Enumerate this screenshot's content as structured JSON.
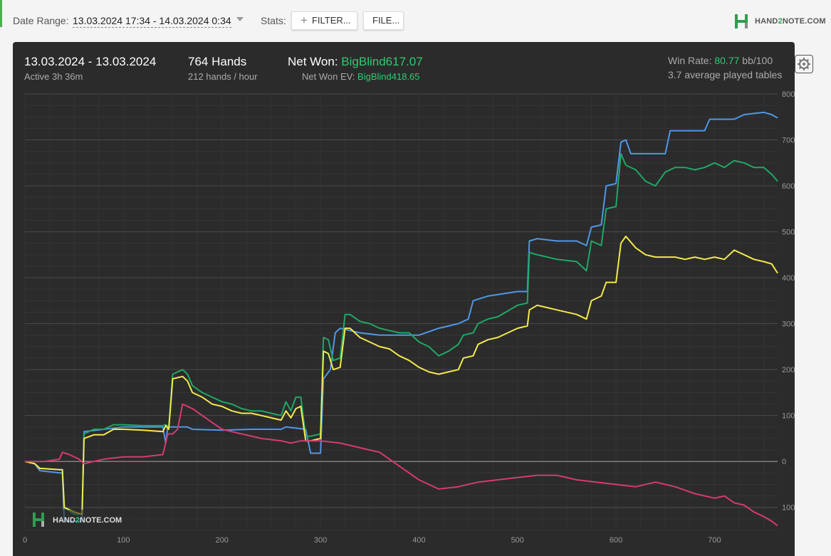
{
  "toolbar": {
    "date_range_label": "Date Range:",
    "date_range_value": "13.03.2024 17:34 - 14.03.2024 0:34",
    "stats_label": "Stats:",
    "filter_button": "FILTER...",
    "file_button": "FILE...",
    "logo_text_a": "HAND",
    "logo_text_b": "2",
    "logo_text_c": "NOTE.COM"
  },
  "summary": {
    "date_range": "13.03.2024 - 13.03.2024",
    "active": "Active 3h 36m",
    "hands": "764 Hands",
    "hands_per_hour": "212 hands / hour",
    "net_won_label": "Net Won: ",
    "net_won_value": "BigBlind617.07",
    "net_won_ev_label": "Net Won  EV: ",
    "net_won_ev_value": "BigBlind418.65",
    "win_rate_label": "Win Rate: ",
    "win_rate_value": "80.77",
    "win_rate_unit": " bb/100",
    "tables": "3.7 average played tables"
  },
  "watermark": {
    "a": "HAND",
    "b": "2",
    "c": "NOTE.COM"
  },
  "colors": {
    "background": "#2b2b2b",
    "green": "#1fa866",
    "blue": "#4f97e8",
    "yellow": "#f2ea4c",
    "red": "#d63a72",
    "accent": "#2ecc71"
  },
  "chart_data": {
    "type": "line",
    "xlim": [
      0,
      764
    ],
    "ylim": [
      -150,
      800
    ],
    "x_ticks": [
      "0",
      "100",
      "200",
      "300",
      "400",
      "500",
      "600",
      "700"
    ],
    "y_ticks": [
      "800",
      "700",
      "600",
      "500",
      "400",
      "300",
      "200",
      "100",
      "0",
      "100"
    ],
    "y_tick_values": [
      800,
      700,
      600,
      500,
      400,
      300,
      200,
      100,
      0,
      -100
    ],
    "grid": true,
    "series": [
      {
        "color": "blue",
        "points": [
          [
            0,
            0
          ],
          [
            10,
            -5
          ],
          [
            15,
            -20
          ],
          [
            35,
            -25
          ],
          [
            38,
            -25
          ],
          [
            40,
            -130
          ],
          [
            58,
            -130
          ],
          [
            60,
            65
          ],
          [
            100,
            75
          ],
          [
            140,
            75
          ],
          [
            143,
            40
          ],
          [
            145,
            75
          ],
          [
            165,
            75
          ],
          [
            170,
            70
          ],
          [
            200,
            68
          ],
          [
            230,
            70
          ],
          [
            260,
            70
          ],
          [
            265,
            75
          ],
          [
            285,
            70
          ],
          [
            290,
            18
          ],
          [
            300,
            18
          ],
          [
            303,
            180
          ],
          [
            310,
            200
          ],
          [
            315,
            280
          ],
          [
            320,
            290
          ],
          [
            340,
            280
          ],
          [
            360,
            275
          ],
          [
            380,
            275
          ],
          [
            400,
            275
          ],
          [
            420,
            290
          ],
          [
            440,
            300
          ],
          [
            450,
            310
          ],
          [
            455,
            350
          ],
          [
            470,
            360
          ],
          [
            500,
            370
          ],
          [
            510,
            370
          ],
          [
            512,
            480
          ],
          [
            520,
            485
          ],
          [
            540,
            480
          ],
          [
            560,
            480
          ],
          [
            570,
            470
          ],
          [
            575,
            510
          ],
          [
            585,
            515
          ],
          [
            590,
            600
          ],
          [
            600,
            605
          ],
          [
            605,
            695
          ],
          [
            610,
            700
          ],
          [
            615,
            670
          ],
          [
            640,
            670
          ],
          [
            650,
            670
          ],
          [
            655,
            720
          ],
          [
            680,
            720
          ],
          [
            690,
            720
          ],
          [
            695,
            745
          ],
          [
            720,
            745
          ],
          [
            730,
            755
          ],
          [
            750,
            760
          ],
          [
            758,
            755
          ],
          [
            764,
            748
          ]
        ]
      },
      {
        "color": "green",
        "points": [
          [
            0,
            0
          ],
          [
            10,
            -5
          ],
          [
            15,
            -15
          ],
          [
            35,
            -18
          ],
          [
            38,
            -18
          ],
          [
            40,
            -100
          ],
          [
            50,
            -115
          ],
          [
            58,
            -115
          ],
          [
            60,
            60
          ],
          [
            70,
            70
          ],
          [
            80,
            70
          ],
          [
            90,
            80
          ],
          [
            100,
            80
          ],
          [
            120,
            78
          ],
          [
            140,
            78
          ],
          [
            143,
            80
          ],
          [
            146,
            75
          ],
          [
            150,
            190
          ],
          [
            160,
            200
          ],
          [
            165,
            190
          ],
          [
            170,
            165
          ],
          [
            180,
            150
          ],
          [
            190,
            140
          ],
          [
            200,
            130
          ],
          [
            210,
            125
          ],
          [
            220,
            115
          ],
          [
            230,
            110
          ],
          [
            240,
            110
          ],
          [
            250,
            105
          ],
          [
            260,
            100
          ],
          [
            265,
            130
          ],
          [
            270,
            110
          ],
          [
            275,
            140
          ],
          [
            280,
            140
          ],
          [
            285,
            55
          ],
          [
            290,
            55
          ],
          [
            300,
            60
          ],
          [
            303,
            270
          ],
          [
            308,
            265
          ],
          [
            313,
            220
          ],
          [
            320,
            225
          ],
          [
            325,
            320
          ],
          [
            330,
            320
          ],
          [
            340,
            305
          ],
          [
            350,
            300
          ],
          [
            360,
            290
          ],
          [
            370,
            285
          ],
          [
            380,
            280
          ],
          [
            390,
            280
          ],
          [
            400,
            260
          ],
          [
            410,
            250
          ],
          [
            420,
            230
          ],
          [
            430,
            240
          ],
          [
            440,
            255
          ],
          [
            445,
            275
          ],
          [
            455,
            280
          ],
          [
            460,
            300
          ],
          [
            470,
            310
          ],
          [
            480,
            315
          ],
          [
            500,
            340
          ],
          [
            510,
            345
          ],
          [
            512,
            455
          ],
          [
            520,
            450
          ],
          [
            540,
            440
          ],
          [
            560,
            435
          ],
          [
            570,
            415
          ],
          [
            575,
            480
          ],
          [
            585,
            470
          ],
          [
            590,
            550
          ],
          [
            600,
            555
          ],
          [
            605,
            670
          ],
          [
            610,
            645
          ],
          [
            620,
            635
          ],
          [
            630,
            610
          ],
          [
            640,
            600
          ],
          [
            650,
            630
          ],
          [
            660,
            640
          ],
          [
            670,
            640
          ],
          [
            680,
            635
          ],
          [
            690,
            640
          ],
          [
            700,
            650
          ],
          [
            710,
            640
          ],
          [
            720,
            655
          ],
          [
            730,
            650
          ],
          [
            740,
            640
          ],
          [
            750,
            640
          ],
          [
            758,
            625
          ],
          [
            764,
            610
          ]
        ]
      },
      {
        "color": "yellow",
        "points": [
          [
            0,
            0
          ],
          [
            10,
            -5
          ],
          [
            15,
            -15
          ],
          [
            35,
            -18
          ],
          [
            38,
            -18
          ],
          [
            40,
            -100
          ],
          [
            50,
            -110
          ],
          [
            58,
            -115
          ],
          [
            60,
            50
          ],
          [
            70,
            58
          ],
          [
            80,
            58
          ],
          [
            90,
            70
          ],
          [
            100,
            70
          ],
          [
            120,
            68
          ],
          [
            140,
            65
          ],
          [
            143,
            78
          ],
          [
            146,
            70
          ],
          [
            150,
            180
          ],
          [
            160,
            185
          ],
          [
            165,
            175
          ],
          [
            170,
            150
          ],
          [
            180,
            140
          ],
          [
            190,
            125
          ],
          [
            200,
            120
          ],
          [
            210,
            110
          ],
          [
            220,
            105
          ],
          [
            230,
            105
          ],
          [
            240,
            100
          ],
          [
            250,
            95
          ],
          [
            260,
            90
          ],
          [
            265,
            110
          ],
          [
            270,
            95
          ],
          [
            275,
            115
          ],
          [
            280,
            120
          ],
          [
            285,
            45
          ],
          [
            290,
            45
          ],
          [
            300,
            50
          ],
          [
            303,
            240
          ],
          [
            308,
            235
          ],
          [
            313,
            200
          ],
          [
            320,
            205
          ],
          [
            325,
            290
          ],
          [
            330,
            290
          ],
          [
            340,
            270
          ],
          [
            350,
            260
          ],
          [
            360,
            250
          ],
          [
            370,
            245
          ],
          [
            380,
            230
          ],
          [
            390,
            220
          ],
          [
            400,
            205
          ],
          [
            410,
            195
          ],
          [
            420,
            190
          ],
          [
            430,
            195
          ],
          [
            440,
            200
          ],
          [
            445,
            225
          ],
          [
            455,
            230
          ],
          [
            460,
            255
          ],
          [
            470,
            265
          ],
          [
            480,
            270
          ],
          [
            500,
            290
          ],
          [
            510,
            295
          ],
          [
            512,
            330
          ],
          [
            520,
            340
          ],
          [
            540,
            330
          ],
          [
            560,
            320
          ],
          [
            570,
            310
          ],
          [
            575,
            350
          ],
          [
            585,
            360
          ],
          [
            590,
            390
          ],
          [
            600,
            390
          ],
          [
            605,
            475
          ],
          [
            610,
            490
          ],
          [
            620,
            465
          ],
          [
            630,
            450
          ],
          [
            640,
            445
          ],
          [
            650,
            445
          ],
          [
            660,
            445
          ],
          [
            670,
            440
          ],
          [
            680,
            445
          ],
          [
            690,
            440
          ],
          [
            700,
            445
          ],
          [
            710,
            440
          ],
          [
            720,
            460
          ],
          [
            730,
            450
          ],
          [
            740,
            440
          ],
          [
            750,
            435
          ],
          [
            758,
            430
          ],
          [
            764,
            410
          ]
        ]
      },
      {
        "color": "red",
        "points": [
          [
            0,
            0
          ],
          [
            20,
            0
          ],
          [
            35,
            5
          ],
          [
            38,
            20
          ],
          [
            45,
            15
          ],
          [
            55,
            5
          ],
          [
            60,
            -5
          ],
          [
            70,
            0
          ],
          [
            80,
            5
          ],
          [
            100,
            10
          ],
          [
            120,
            10
          ],
          [
            140,
            15
          ],
          [
            145,
            60
          ],
          [
            150,
            60
          ],
          [
            155,
            70
          ],
          [
            160,
            125
          ],
          [
            165,
            120
          ],
          [
            170,
            115
          ],
          [
            180,
            100
          ],
          [
            190,
            85
          ],
          [
            200,
            70
          ],
          [
            210,
            65
          ],
          [
            220,
            60
          ],
          [
            240,
            50
          ],
          [
            260,
            45
          ],
          [
            270,
            40
          ],
          [
            280,
            45
          ],
          [
            300,
            45
          ],
          [
            320,
            40
          ],
          [
            340,
            30
          ],
          [
            360,
            20
          ],
          [
            380,
            -10
          ],
          [
            400,
            -40
          ],
          [
            420,
            -60
          ],
          [
            440,
            -55
          ],
          [
            460,
            -45
          ],
          [
            480,
            -40
          ],
          [
            500,
            -35
          ],
          [
            520,
            -30
          ],
          [
            540,
            -30
          ],
          [
            560,
            -40
          ],
          [
            580,
            -45
          ],
          [
            600,
            -50
          ],
          [
            620,
            -55
          ],
          [
            640,
            -45
          ],
          [
            660,
            -55
          ],
          [
            680,
            -70
          ],
          [
            700,
            -80
          ],
          [
            710,
            -75
          ],
          [
            720,
            -90
          ],
          [
            730,
            -95
          ],
          [
            740,
            -110
          ],
          [
            750,
            -120
          ],
          [
            758,
            -130
          ],
          [
            764,
            -140
          ]
        ]
      }
    ]
  }
}
